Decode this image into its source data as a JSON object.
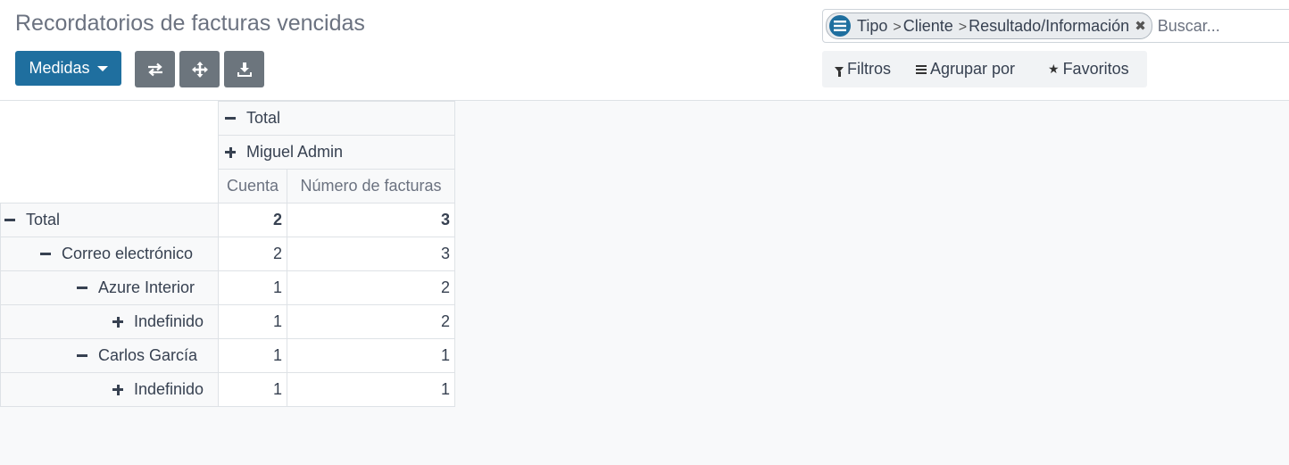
{
  "header": {
    "title": "Recordatorios de facturas vencidas"
  },
  "toolbar": {
    "measures_label": "Medidas",
    "buttons": [
      {
        "icon": "swap-axes-icon"
      },
      {
        "icon": "expand-all-icon"
      },
      {
        "icon": "download-icon"
      }
    ]
  },
  "search": {
    "facet": {
      "icon": "group-by-icon",
      "parts": [
        "Tipo",
        "Cliente",
        "Resultado/Información"
      ]
    },
    "placeholder": "Buscar..."
  },
  "filters": {
    "filters_label": "Filtros",
    "group_by_label": "Agrupar por",
    "favorites_label": "Favoritos"
  },
  "pivot": {
    "col_header_total": "Total",
    "col_header_group": "Miguel Admin",
    "measures": [
      "Cuenta",
      "Número de facturas"
    ],
    "rows": [
      {
        "label": "Total",
        "expanded": true,
        "level": 0,
        "count": "2",
        "invoices": "3",
        "bold": true
      },
      {
        "label": "Correo electrónico",
        "expanded": true,
        "level": 1,
        "count": "2",
        "invoices": "3"
      },
      {
        "label": "Azure Interior",
        "expanded": true,
        "level": 2,
        "count": "1",
        "invoices": "2"
      },
      {
        "label": "Indefinido",
        "expanded": false,
        "level": 3,
        "count": "1",
        "invoices": "2"
      },
      {
        "label": "Carlos García",
        "expanded": true,
        "level": 2,
        "count": "1",
        "invoices": "1"
      },
      {
        "label": "Indefinido",
        "expanded": false,
        "level": 3,
        "count": "1",
        "invoices": "1"
      }
    ]
  },
  "colors": {
    "primary": "#1f6f9f",
    "secondary": "#6c757d"
  }
}
